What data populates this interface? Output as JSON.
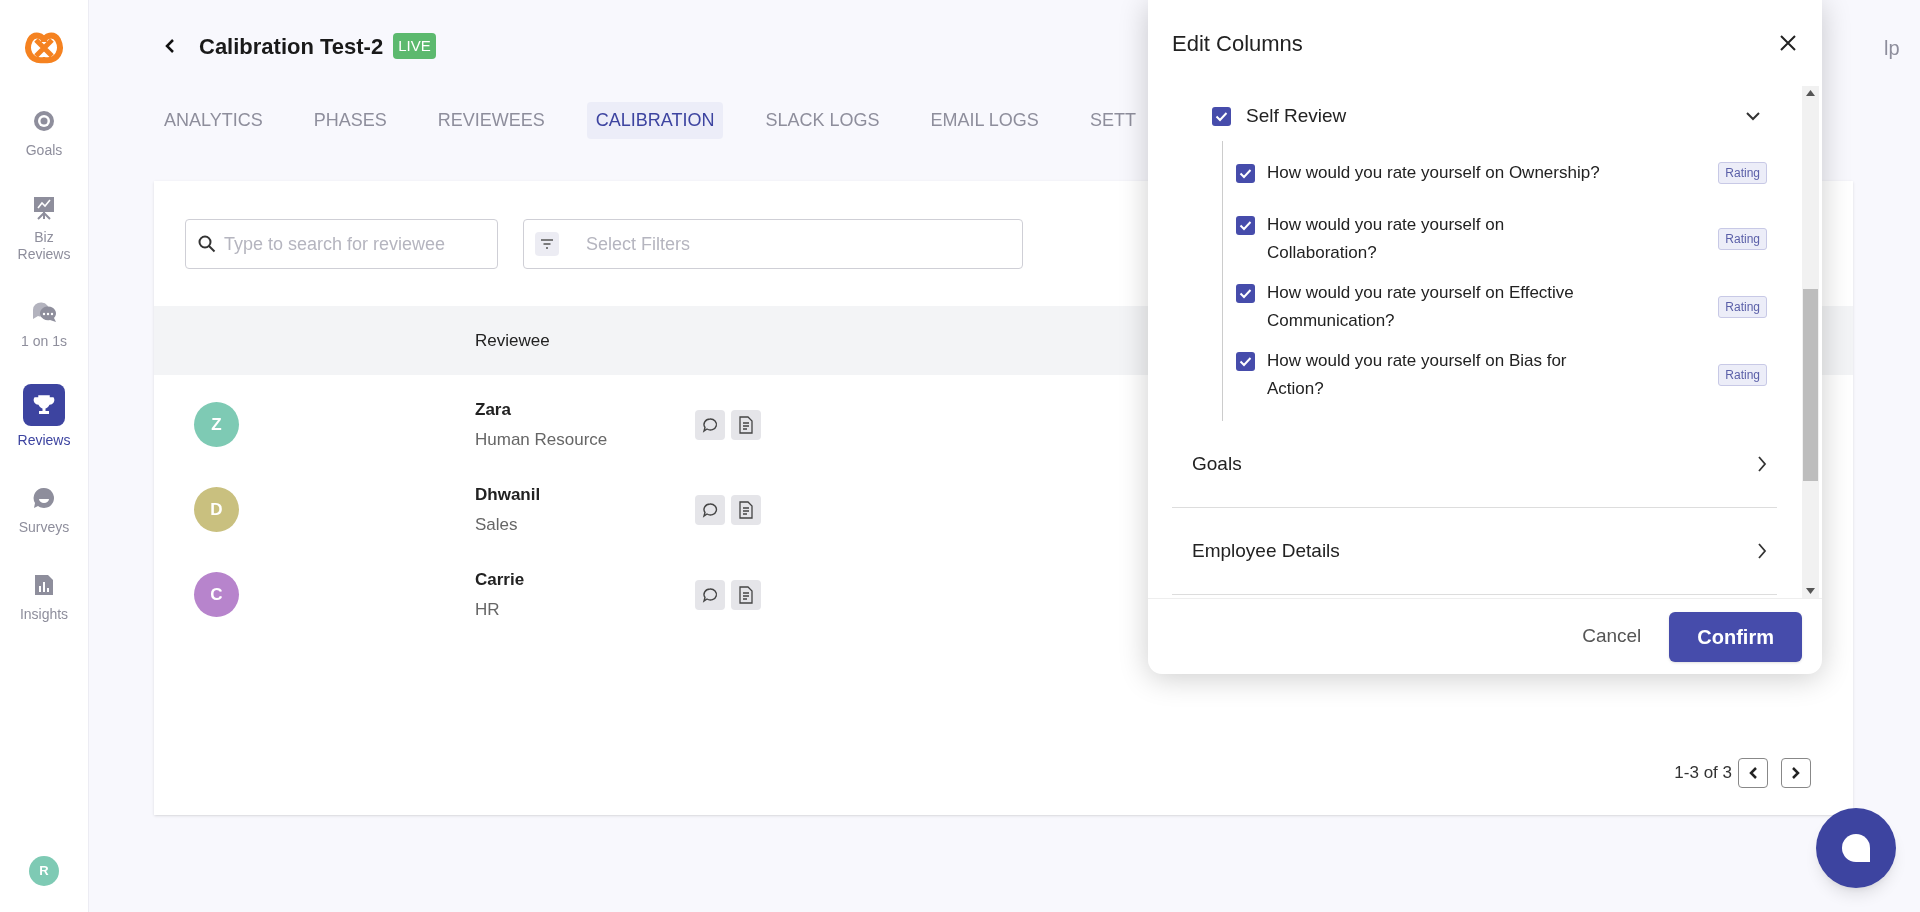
{
  "sidebar": {
    "items": [
      {
        "label": "Goals",
        "selected": false
      },
      {
        "label": "Biz\nReviews",
        "selected": false
      },
      {
        "label": "1 on 1s",
        "selected": false
      },
      {
        "label": "Reviews",
        "selected": true
      },
      {
        "label": "Surveys",
        "selected": false
      },
      {
        "label": "Insights",
        "selected": false
      }
    ],
    "user_avatar": "R"
  },
  "header": {
    "title": "Calibration Test-2",
    "status_badge": "LIVE",
    "partial_link": "lp"
  },
  "tabs": [
    {
      "label": "ANALYTICS",
      "selected": false
    },
    {
      "label": "PHASES",
      "selected": false
    },
    {
      "label": "REVIEWEES",
      "selected": false
    },
    {
      "label": "CALIBRATION",
      "selected": true
    },
    {
      "label": "SLACK LOGS",
      "selected": false
    },
    {
      "label": "EMAIL LOGS",
      "selected": false
    },
    {
      "label": "SETT",
      "selected": false
    }
  ],
  "search": {
    "placeholder": "Type to search for reviewee"
  },
  "filters": {
    "placeholder": "Select Filters"
  },
  "table": {
    "columns": [
      "Reviewee"
    ],
    "rows": [
      {
        "initial": "Z",
        "color": "#7ecab4",
        "name": "Zara",
        "department": "Human Resource"
      },
      {
        "initial": "D",
        "color": "#c9c07f",
        "name": "Dhwanil",
        "department": "Sales"
      },
      {
        "initial": "C",
        "color": "#b784cc",
        "name": "Carrie",
        "department": "HR"
      }
    ]
  },
  "pagination": {
    "range": "1-3 of 3"
  },
  "modal": {
    "title": "Edit Columns",
    "sections": [
      {
        "kind": "group",
        "label": "Self Review",
        "checked": true,
        "expanded": true,
        "children": [
          {
            "label": "How would you rate yourself on Ownership?",
            "checked": true,
            "tag": "Rating"
          },
          {
            "label": "How would you rate yourself on Collaboration?",
            "checked": true,
            "tag": "Rating"
          },
          {
            "label": "How would you rate yourself on Effective Communication?",
            "checked": true,
            "tag": "Rating"
          },
          {
            "label": "How would you rate yourself on Bias for Action?",
            "checked": true,
            "tag": "Rating"
          }
        ]
      },
      {
        "kind": "group",
        "label": "Goals",
        "expanded": false
      },
      {
        "kind": "group",
        "label": "Employee Details",
        "expanded": false
      }
    ],
    "buttons": [
      {
        "kind": "secondary",
        "label": "Cancel"
      },
      {
        "kind": "primary",
        "label": "Confirm"
      }
    ]
  }
}
